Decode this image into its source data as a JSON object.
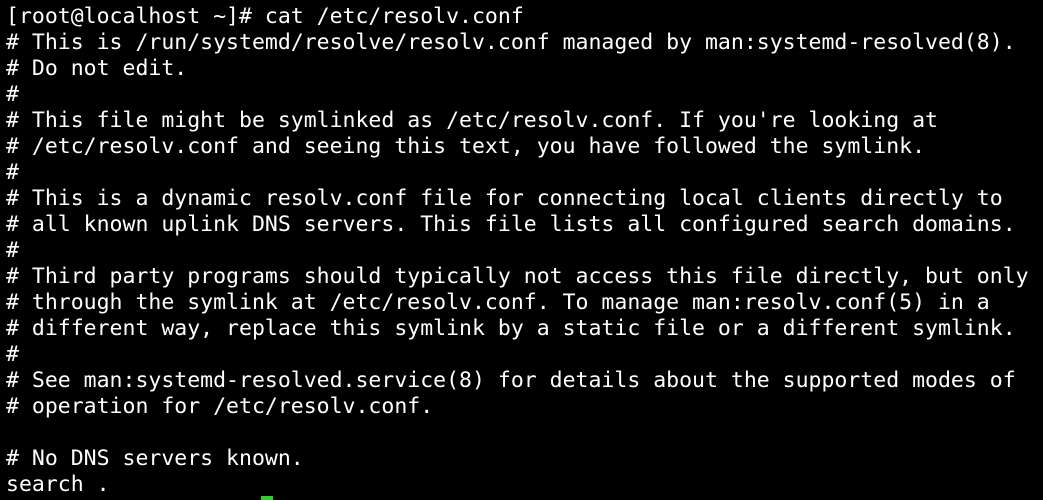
{
  "terminal": {
    "lines": [
      "[root@localhost ~]# cat /etc/resolv.conf",
      "# This is /run/systemd/resolve/resolv.conf managed by man:systemd-resolved(8).",
      "# Do not edit.",
      "#",
      "# This file might be symlinked as /etc/resolv.conf. If you're looking at",
      "# /etc/resolv.conf and seeing this text, you have followed the symlink.",
      "#",
      "# This is a dynamic resolv.conf file for connecting local clients directly to",
      "# all known uplink DNS servers. This file lists all configured search domains.",
      "#",
      "# Third party programs should typically not access this file directly, but only",
      "# through the symlink at /etc/resolv.conf. To manage man:resolv.conf(5) in a",
      "# different way, replace this symlink by a static file or a different symlink.",
      "#",
      "# See man:systemd-resolved.service(8) for details about the supported modes of",
      "# operation for /etc/resolv.conf.",
      "",
      "# No DNS servers known.",
      "search ."
    ]
  },
  "colors": {
    "background": "#000000",
    "foreground": "#ffffff",
    "cursor": "#33cc33"
  }
}
